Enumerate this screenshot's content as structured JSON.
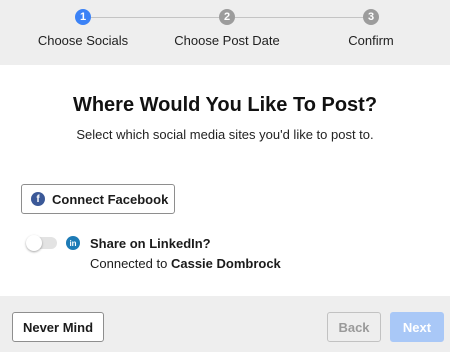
{
  "stepper": {
    "steps": [
      {
        "number": "1",
        "label": "Choose Socials",
        "state": "active"
      },
      {
        "number": "2",
        "label": "Choose Post Date",
        "state": "inactive"
      },
      {
        "number": "3",
        "label": "Confirm",
        "state": "inactive"
      }
    ]
  },
  "main": {
    "title": "Where Would You Like To Post?",
    "subtitle": "Select which social media sites you'd like to post to.",
    "facebook": {
      "icon": "facebook-icon",
      "label": "Connect Facebook"
    },
    "linkedin": {
      "icon": "linkedin-icon",
      "toggle_on": false,
      "title": "Share on LinkedIn?",
      "connected_prefix": "Connected to",
      "account_name": "Cassie Dombrock"
    }
  },
  "footer": {
    "never_mind_label": "Never Mind",
    "back_label": "Back",
    "next_label": "Next"
  },
  "colors": {
    "accent": "#3b82f6",
    "facebook": "#3b5998",
    "linkedin": "#1d7bb6",
    "next_disabled": "#a9c8f7"
  }
}
